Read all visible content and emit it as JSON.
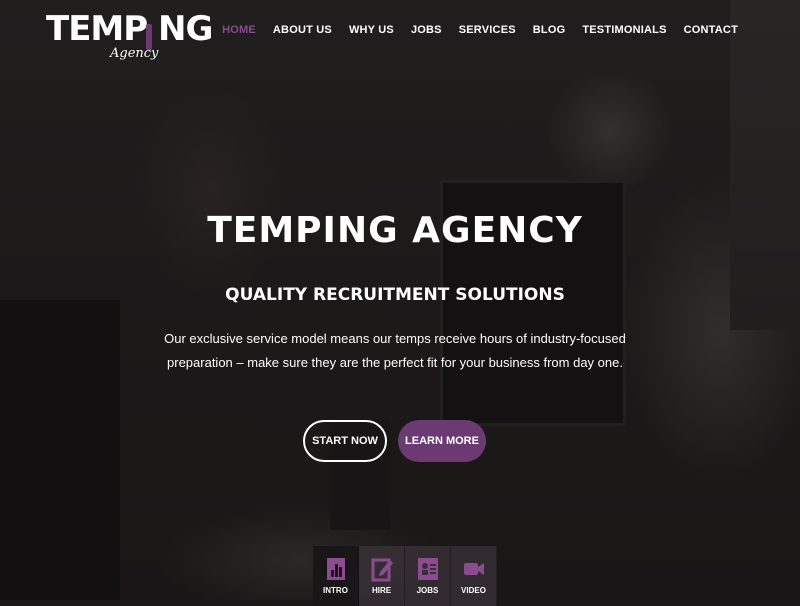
{
  "logo": {
    "main": "TEMP NG",
    "sub": "Agency"
  },
  "nav": {
    "items": [
      {
        "label": "HOME",
        "active": true
      },
      {
        "label": "ABOUT US",
        "active": false
      },
      {
        "label": "WHY US",
        "active": false
      },
      {
        "label": "JOBS",
        "active": false
      },
      {
        "label": "SERVICES",
        "active": false
      },
      {
        "label": "BLOG",
        "active": false
      },
      {
        "label": "TESTIMONIALS",
        "active": false
      },
      {
        "label": "CONTACT",
        "active": false
      }
    ]
  },
  "hero": {
    "title": "TEMPING AGENCY",
    "subtitle": "QUALITY RECRUITMENT SOLUTIONS",
    "text": "Our exclusive service model means our temps receive hours of industry-focused preparation – make sure they are the perfect fit for your business from day one.",
    "start_button": "START NOW",
    "more_button": "LEARN MORE"
  },
  "tabs": [
    {
      "label": "INTRO",
      "icon": "bar-chart-icon",
      "active": true
    },
    {
      "label": "HIRE",
      "icon": "edit-icon",
      "active": false
    },
    {
      "label": "JOBS",
      "icon": "id-card-icon",
      "active": false
    },
    {
      "label": "VIDEO",
      "icon": "video-camera-icon",
      "active": false
    }
  ],
  "colors": {
    "accent": "#6b3a73",
    "active_nav": "#8a4b8f",
    "text": "#ffffff"
  }
}
